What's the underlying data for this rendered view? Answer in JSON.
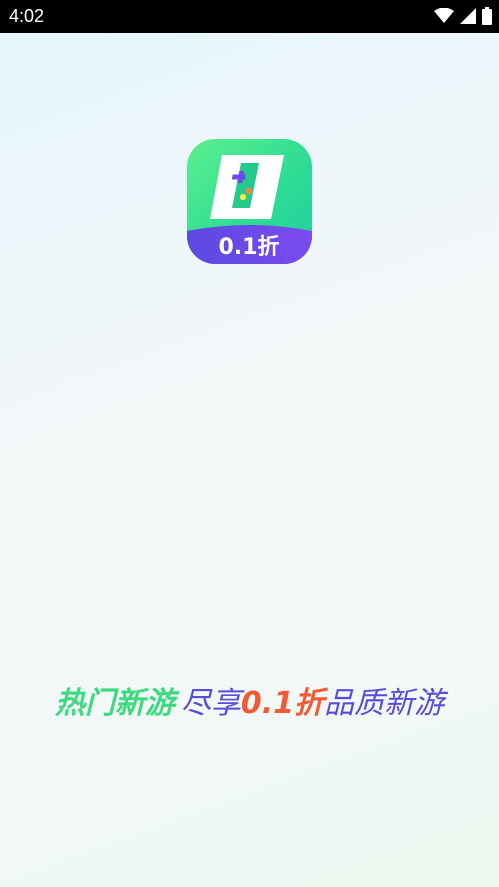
{
  "status_bar": {
    "time": "4:02",
    "icons": [
      "wifi-icon",
      "signal-icon",
      "battery-icon"
    ]
  },
  "app_icon": {
    "name": "app-logo-icon",
    "badge_text": "0.1折",
    "colors": {
      "top_green": "#3ee58f",
      "bottom_purple": "#6a4be8"
    }
  },
  "slogan": {
    "part1": "热门新游",
    "part2": "尽享",
    "part3": "0.1折",
    "part4": "品质新游",
    "colors": {
      "green": "#3fd97f",
      "purple": "#5f49d8",
      "orange": "#f25a36"
    }
  }
}
